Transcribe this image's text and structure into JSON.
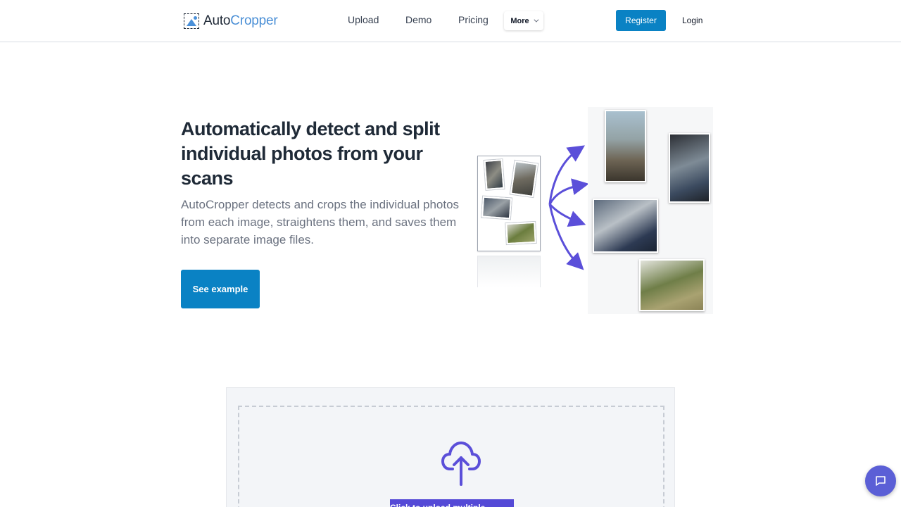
{
  "brand": {
    "part1": "Auto",
    "part2": "Cropper"
  },
  "nav": {
    "upload": "Upload",
    "demo": "Demo",
    "pricing": "Pricing",
    "more": "More",
    "register": "Register",
    "login": "Login"
  },
  "hero": {
    "title": "Automatically detect and split individual photos from your scans",
    "subtitle": "AutoCropper detects and crops the individual photos from each image, straightens them, and saves them into separate image files.",
    "cta": "See example"
  },
  "upload": {
    "button": "Click to upload multiple images"
  },
  "colors": {
    "primary": "#0a82c4",
    "accent": "#5449d6",
    "arrow": "#5b4fd9"
  },
  "icons": {
    "logo": "crop-image-icon",
    "more": "chevron-down-icon",
    "upload": "cloud-upload-icon",
    "chat": "chat-bubble-icon"
  }
}
